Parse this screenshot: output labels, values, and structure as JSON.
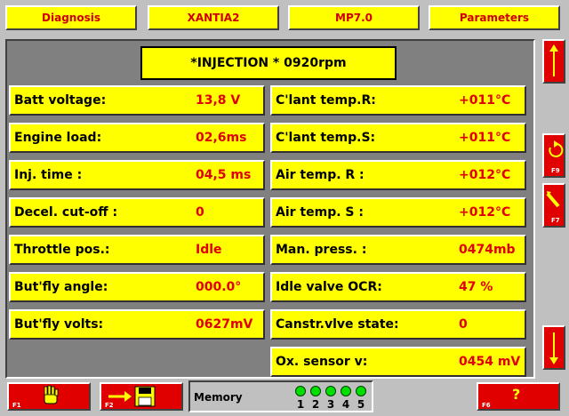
{
  "tabs": [
    "Diagnosis",
    "XANTIA2",
    "MP7.0",
    "Parameters"
  ],
  "title": "*INJECTION * 0920rpm",
  "left_params": [
    {
      "label": "Batt voltage:",
      "value": "13,8 V"
    },
    {
      "label": "Engine load:",
      "value": "02,6ms"
    },
    {
      "label": "Inj. time  :",
      "value": "04,5 ms"
    },
    {
      "label": "Decel. cut-off :",
      "value": "0"
    },
    {
      "label": "Throttle pos.:",
      "value": "Idle"
    },
    {
      "label": "But'fly angle:",
      "value": "000.0°"
    },
    {
      "label": "But'fly volts:",
      "value": "0627mV"
    }
  ],
  "right_params": [
    {
      "label": "C'lant temp.R:",
      "value": "+011°C"
    },
    {
      "label": "C'lant temp.S:",
      "value": "+011°C"
    },
    {
      "label": "Air temp. R :",
      "value": "+012°C"
    },
    {
      "label": "Air temp. S :",
      "value": "+012°C"
    },
    {
      "label": "Man. press. :",
      "value": "0474mb"
    },
    {
      "label": "Idle valve OCR:",
      "value": "47 %"
    },
    {
      "label": "Canstr.vlve state:",
      "value": "0"
    },
    {
      "label": "Ox. sensor v:",
      "value": "0454 mV"
    }
  ],
  "side_buttons": {
    "refresh_key": "F9",
    "pen_key": "F7"
  },
  "footer": {
    "f1_key": "F1",
    "f2_key": "F2",
    "memory_label": "Memory",
    "memory_slots": [
      "1",
      "2",
      "3",
      "4",
      "5"
    ],
    "help_key": "F6",
    "help_symbol": "?"
  },
  "icons": {
    "scroll_up": "arrow-up-icon",
    "refresh": "refresh-icon",
    "pen": "pen-icon",
    "scroll_down": "arrow-down-icon",
    "stop": "hand-icon",
    "save": "floppy-disk-icon"
  },
  "colors": {
    "accent": "#e00000",
    "cell": "#ffff00",
    "led": "#00e000"
  }
}
